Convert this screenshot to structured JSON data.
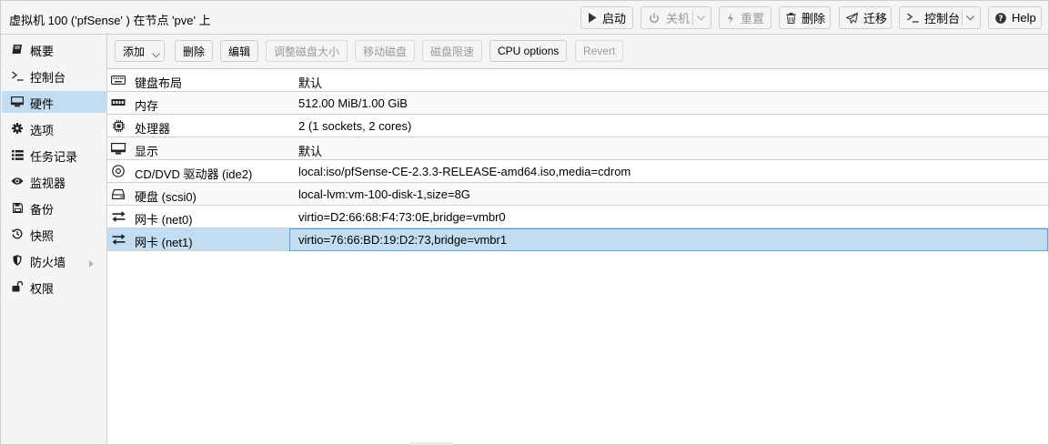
{
  "header": {
    "title": "虚拟机 100 ('pfSense' ) 在节点 'pve' 上",
    "buttons": {
      "start": "启动",
      "shutdown": "关机",
      "reset": "重置",
      "remove": "删除",
      "migrate": "迁移",
      "console": "控制台",
      "help": "Help"
    }
  },
  "sidebar": {
    "items": [
      {
        "label": "概要",
        "icon": "book-icon"
      },
      {
        "label": "控制台",
        "icon": "terminal-icon"
      },
      {
        "label": "硬件",
        "icon": "desktop-icon"
      },
      {
        "label": "选项",
        "icon": "gear-icon"
      },
      {
        "label": "任务记录",
        "icon": "list-icon"
      },
      {
        "label": "监视器",
        "icon": "eye-icon"
      },
      {
        "label": "备份",
        "icon": "floppy-icon"
      },
      {
        "label": "快照",
        "icon": "history-icon"
      },
      {
        "label": "防火墙",
        "icon": "shield-icon"
      },
      {
        "label": "权限",
        "icon": "unlock-icon"
      }
    ],
    "active_index": 2
  },
  "toolbar": {
    "add": "添加",
    "delete": "删除",
    "edit": "编辑",
    "resize_disk": "调整磁盘大小",
    "move_disk": "移动磁盘",
    "disk_throttle": "磁盘限速",
    "cpu_options": "CPU options",
    "revert": "Revert"
  },
  "hardware": {
    "rows": [
      {
        "icon": "keyboard-icon",
        "name": "键盘布局",
        "value": "默认"
      },
      {
        "icon": "memory-icon",
        "name": "内存",
        "value": "512.00 MiB/1.00 GiB"
      },
      {
        "icon": "cpu-icon",
        "name": "处理器",
        "value": "2 (1 sockets, 2 cores)"
      },
      {
        "icon": "desktop-icon",
        "name": "显示",
        "value": "默认"
      },
      {
        "icon": "cdrom-icon",
        "name": "CD/DVD 驱动器 (ide2)",
        "value": "local:iso/pfSense-CE-2.3.3-RELEASE-amd64.iso,media=cdrom"
      },
      {
        "icon": "hdd-icon",
        "name": "硬盘 (scsi0)",
        "value": "local-lvm:vm-100-disk-1,size=8G"
      },
      {
        "icon": "exchange-icon",
        "name": "网卡 (net0)",
        "value": "virtio=D2:66:68:F4:73:0E,bridge=vmbr0"
      },
      {
        "icon": "exchange-icon",
        "name": "网卡 (net1)",
        "value": "virtio=76:66:BD:19:D2:73,bridge=vmbr1"
      }
    ],
    "selected_index": 7
  },
  "colors": {
    "selection": "#c2ddf2",
    "selection_border": "#5fa2dd",
    "panel_bg": "#f5f5f5",
    "border": "#cfcfcf"
  }
}
